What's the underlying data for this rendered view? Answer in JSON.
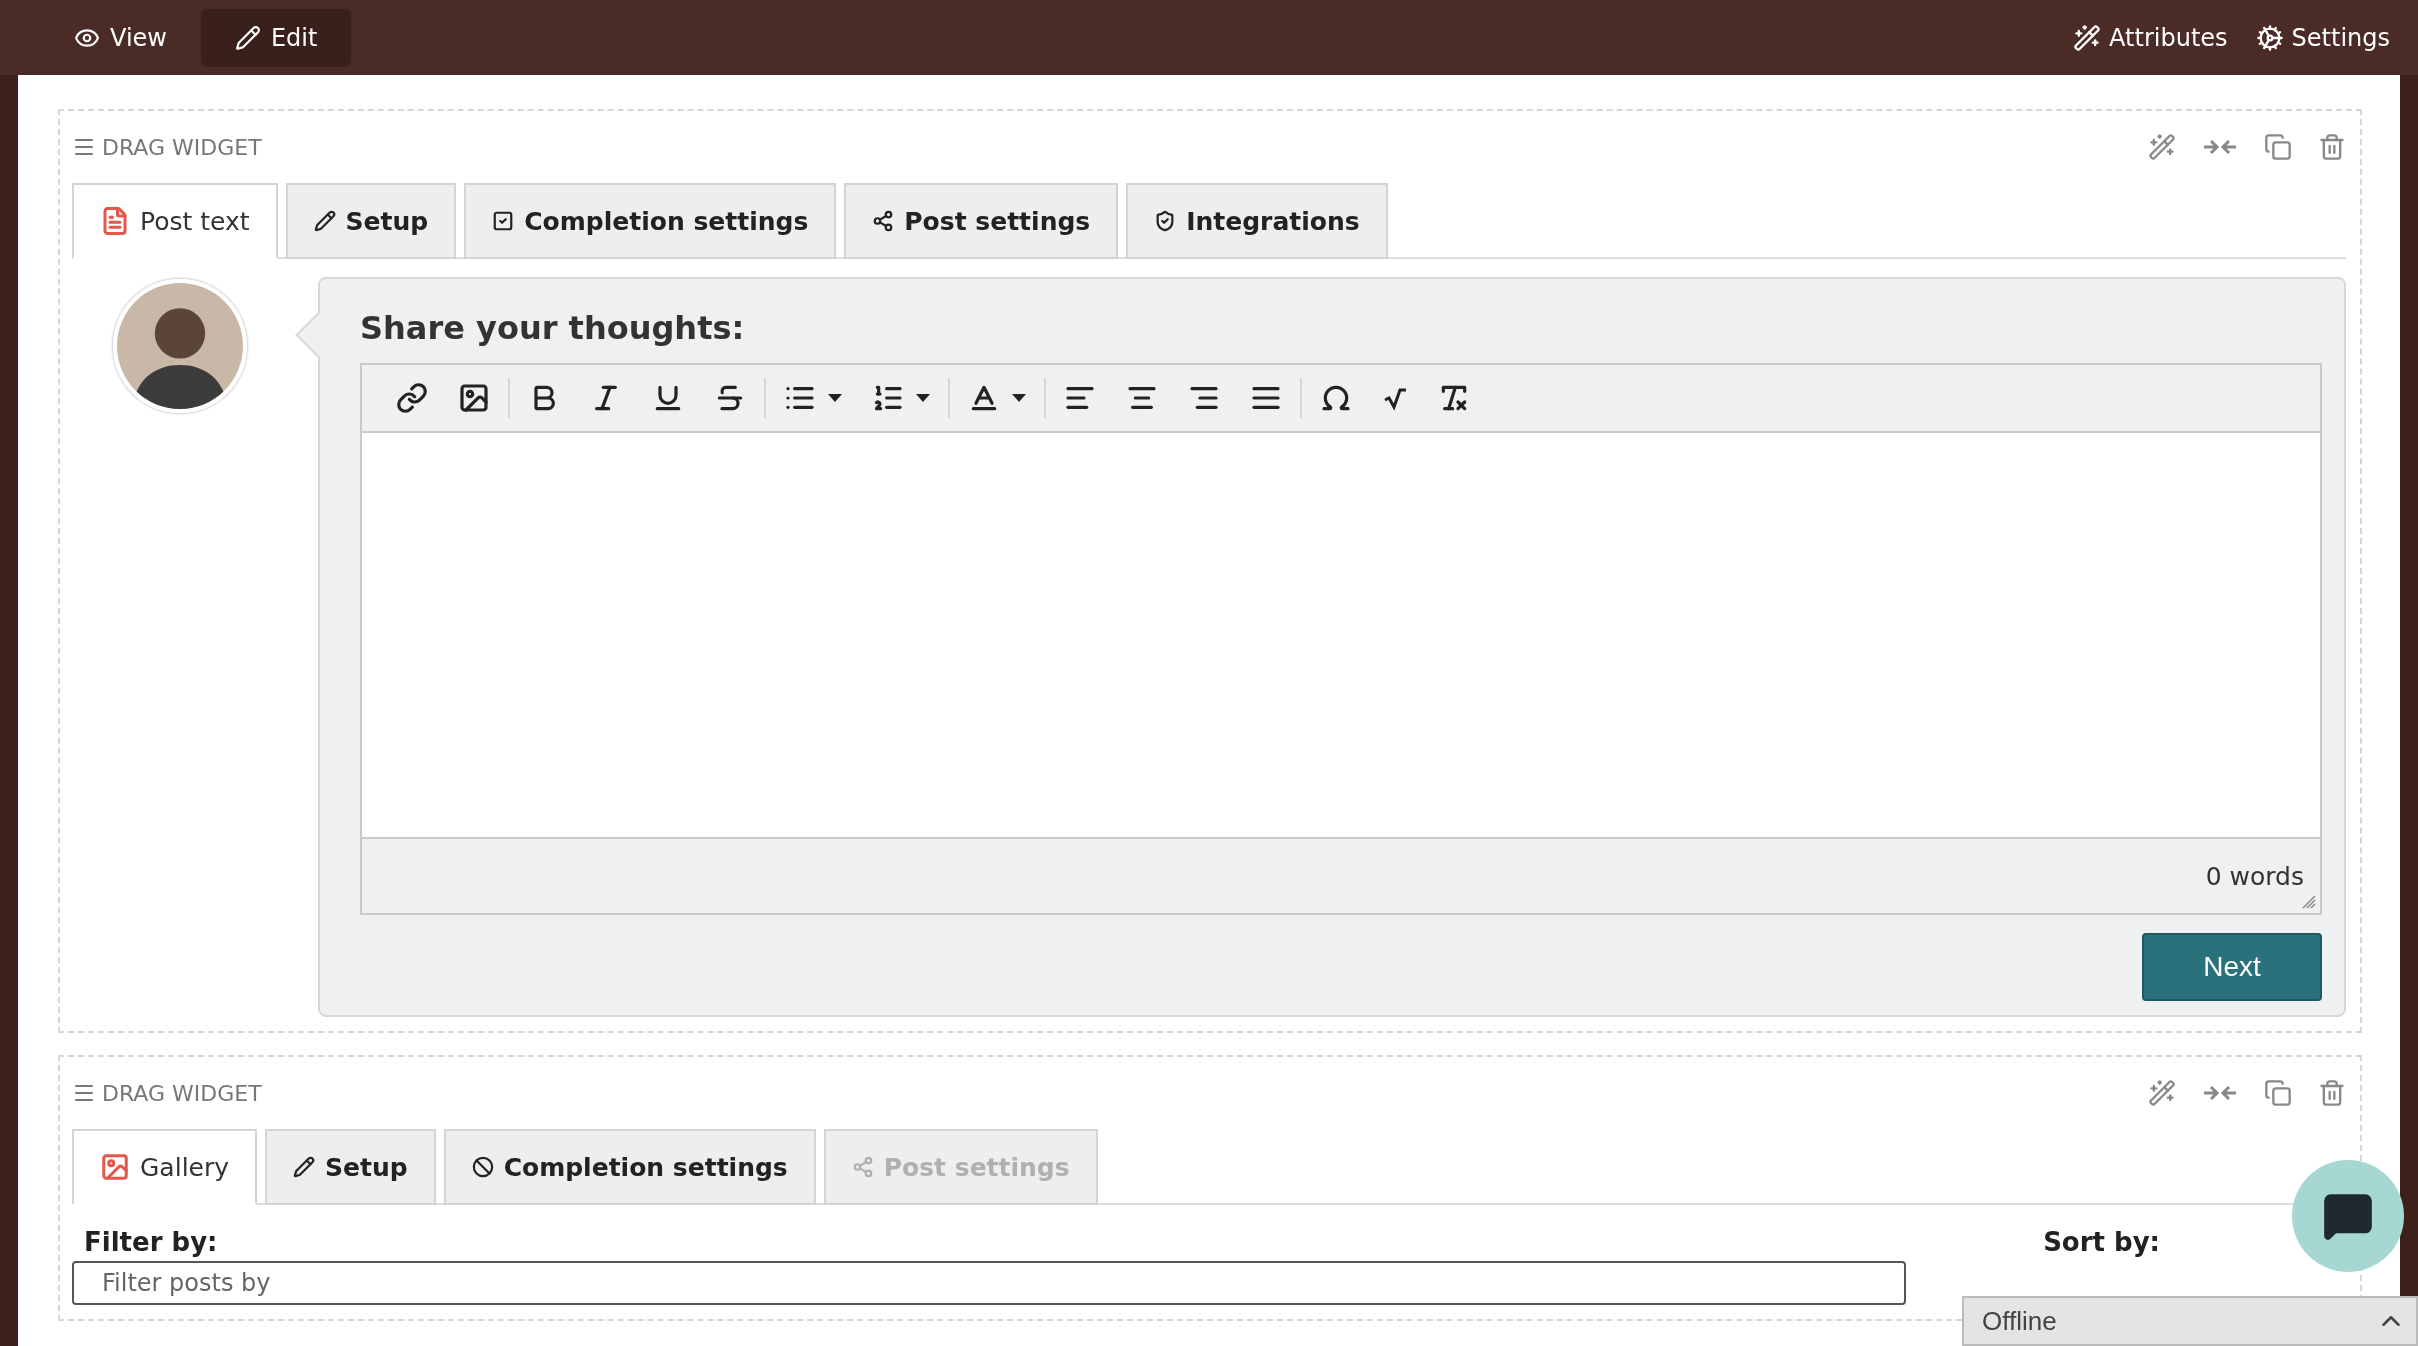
{
  "top_bar": {
    "modes": [
      {
        "label": "View",
        "selected": false
      },
      {
        "label": "Edit",
        "selected": true
      }
    ],
    "actions": [
      {
        "label": "Attributes"
      },
      {
        "label": "Settings"
      }
    ]
  },
  "widgets": [
    {
      "handle_label": "DRAG WIDGET",
      "tabs": [
        {
          "label": "Post text",
          "selected": true,
          "disabled": false
        },
        {
          "label": "Setup",
          "selected": false,
          "disabled": false
        },
        {
          "label": "Completion settings",
          "selected": false,
          "disabled": false
        },
        {
          "label": "Post settings",
          "selected": false,
          "disabled": false
        },
        {
          "label": "Integrations",
          "selected": false,
          "disabled": false
        }
      ],
      "composer": {
        "title": "Share your thoughts:",
        "word_count": "0 words",
        "button": "Next"
      }
    },
    {
      "handle_label": "DRAG WIDGET",
      "tabs": [
        {
          "label": "Gallery",
          "selected": true,
          "disabled": false
        },
        {
          "label": "Setup",
          "selected": false,
          "disabled": false
        },
        {
          "label": "Completion settings",
          "selected": false,
          "disabled": false
        },
        {
          "label": "Post settings",
          "selected": false,
          "disabled": true
        }
      ],
      "filter": {
        "label": "Filter by:",
        "placeholder": "Filter posts by"
      },
      "sort_label": "Sort by:"
    }
  ],
  "chat": {
    "status": "Offline"
  }
}
